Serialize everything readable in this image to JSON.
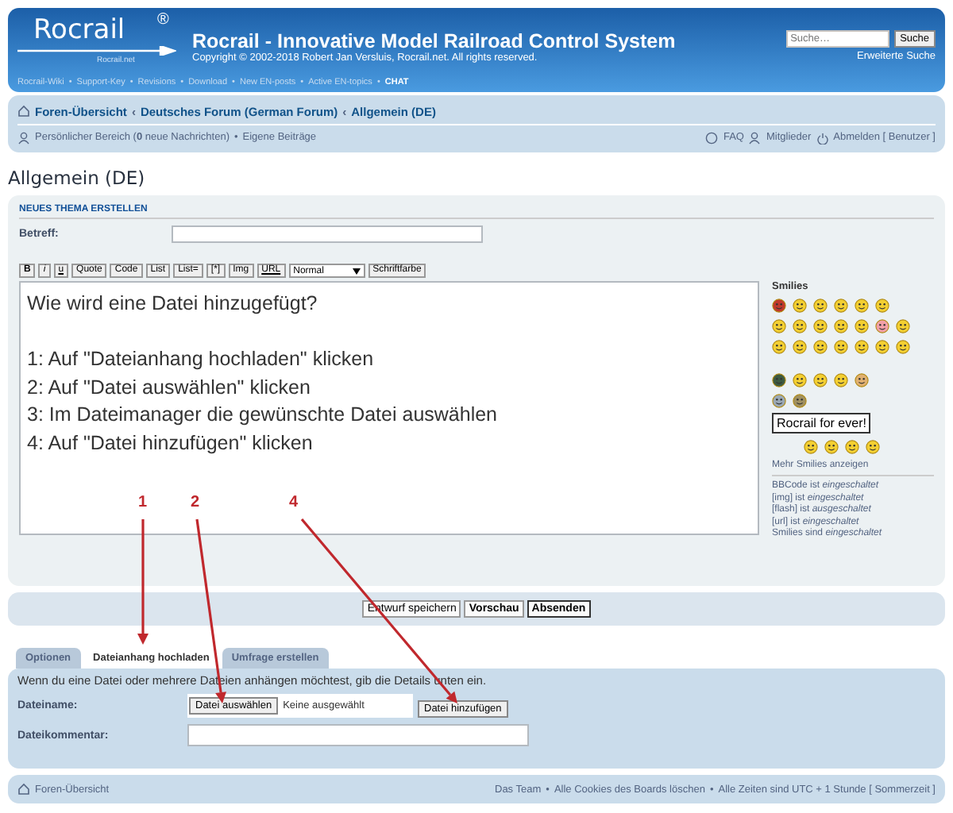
{
  "header": {
    "logo": "Rocrail",
    "logo_mark": "®",
    "logo_sub": "Rocrail.net",
    "title": "Rocrail - Innovative Model Railroad Control System",
    "copyright": "Copyright © 2002-2018 Robert Jan Versluis, Rocrail.net. All rights reserved.",
    "links": [
      {
        "text": "Rocrail-Wiki"
      },
      {
        "sep": "•",
        "text": "Support-Key"
      },
      {
        "sep": "•",
        "text": "Revisions"
      },
      {
        "sep": "•",
        "text": "Download"
      },
      {
        "sep": "•",
        "text": "New EN-posts"
      },
      {
        "sep": "•",
        "text": "Active EN-topics"
      },
      {
        "sep": "•",
        "text": "CHAT",
        "bold": true
      }
    ],
    "search": {
      "placeholder": "Suche…",
      "button": "Suche",
      "advanced": "Erweiterte Suche"
    }
  },
  "breadcrumb": [
    {
      "text": "Foren-Übersicht"
    },
    {
      "sep": "‹",
      "text": "Deutsches Forum (German Forum)"
    },
    {
      "sep": "‹",
      "text": "Allgemein (DE)"
    }
  ],
  "user_bar": {
    "left": [
      {
        "text": "Persönlicher Bereich (**0** neue Nachrichten)"
      },
      {
        "sep": "•",
        "text": "Eigene Beiträge"
      }
    ],
    "faq": "FAQ",
    "members": "Mitglieder",
    "logout": "Abmelden [ Benutzer ]"
  },
  "page_title": "Allgemein (DE)",
  "post": {
    "heading": "NEUES THEMA ERSTELLEN",
    "subject_label": "Betreff:",
    "toolbar": [
      "B",
      "i",
      "u",
      "Quote",
      "Code",
      "List",
      "List=",
      "[*]",
      "Img",
      "URL"
    ],
    "font_size": "Normal",
    "font_color": "Schriftfarbe",
    "question": "Wie wird eine Datei hinzugefügt?",
    "message": [
      "1: Auf \"Dateianhang hochladen\" klicken",
      "2: Auf \"Datei auswählen\" klicken",
      "3: Im Dateimanager die gewünschte Datei auswählen",
      "4: Auf \"Datei hinzufügen\" klicken"
    ],
    "smilies_title": "Smilies",
    "smiley_sign": "Rocrail for ever!",
    "more_smilies": "Mehr Smilies anzeigen",
    "status": [
      "BBCode ist *eingeschaltet*",
      "[img] ist *eingeschaltet*",
      "[flash] ist *ausgeschaltet*",
      "[url] ist *eingeschaltet*",
      "Smilies sind *eingeschaltet*"
    ]
  },
  "actions": [
    {
      "label": "Entwurf speichern",
      "kind": "plain"
    },
    {
      "label": "Vorschau",
      "kind": "bold"
    },
    {
      "label": "Absenden",
      "kind": "primary"
    }
  ],
  "tabs": [
    {
      "label": "Optionen",
      "selected": false
    },
    {
      "label": "Dateianhang hochladen",
      "selected": true
    },
    {
      "label": "Umfrage erstellen",
      "selected": false
    }
  ],
  "attachment": {
    "intro": "Wenn du eine Datei oder mehrere Dateien anhängen möchtest, gib die Details unten ein.",
    "filename_label": "Dateiname:",
    "choose_button": "Datei auswählen",
    "no_file": "Keine ausgewählt",
    "add_button": "Datei hinzufügen",
    "comment_label": "Dateikommentar:"
  },
  "footer": {
    "home": "Foren-Übersicht",
    "links": [
      {
        "text": "Das Team"
      },
      {
        "sep": "•",
        "text": "Alle Cookies des Boards löschen"
      },
      {
        "sep": "•",
        "text": "Alle Zeiten sind UTC + 1 Stunde [ Sommerzeit ]"
      }
    ]
  },
  "annotations": [
    {
      "label": "1"
    },
    {
      "label": "2"
    },
    {
      "label": "4"
    }
  ]
}
